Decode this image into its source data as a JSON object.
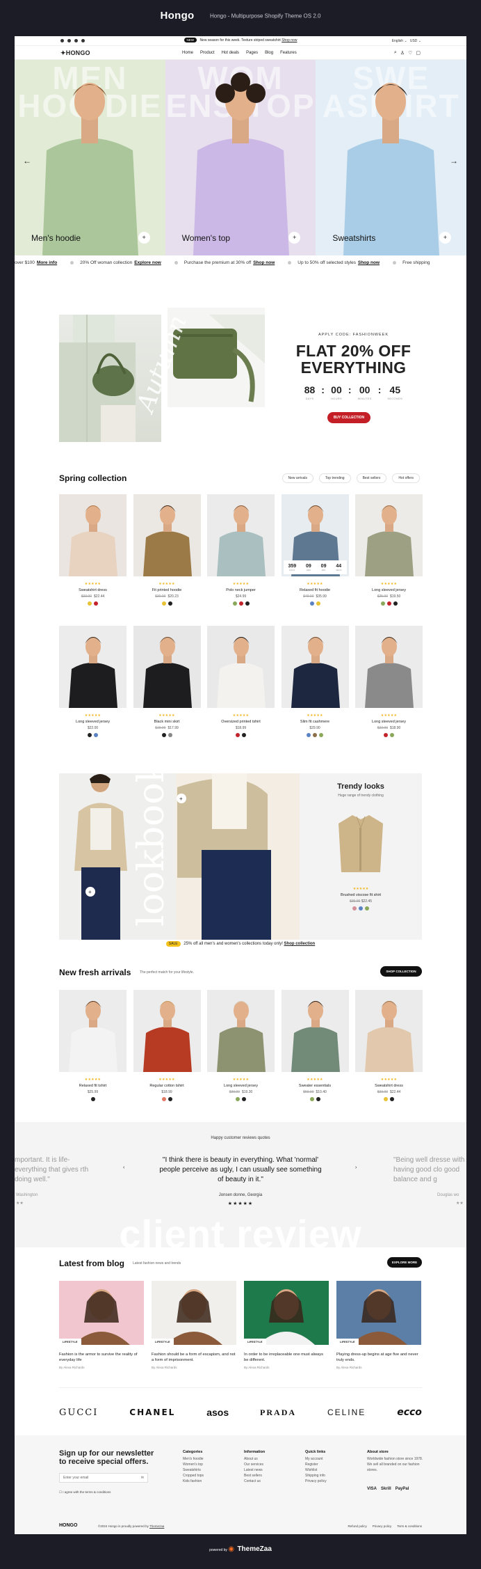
{
  "frame": {
    "logo": "Hongo",
    "subtitle": "Hongo - Multipurpose Shopify Theme OS 2.0"
  },
  "topbar": {
    "badge": "NEW",
    "announcement": "New season for this week. Texture striped sweatshirt",
    "announcement_link": "Shop now",
    "language": "English",
    "currency": "USD"
  },
  "nav": {
    "brand": "HONGO",
    "menu": [
      "Home",
      "Product",
      "Hot deals",
      "Pages",
      "Blog",
      "Features"
    ]
  },
  "hero": {
    "panels": [
      {
        "caption": "Men's hoodie",
        "bg_word": "MEN HOO DIE",
        "color": "#e2ebd6"
      },
      {
        "caption": "Women's top",
        "bg_word": "WOM ENS TOP",
        "color": "#e7dfee"
      },
      {
        "caption": "Sweatshirts",
        "bg_word": "SWE ASH IRT",
        "color": "#e3eef6"
      }
    ]
  },
  "ticker": [
    {
      "text": "over $100",
      "link": "More info"
    },
    {
      "text": "20% Off woman collection",
      "link": "Explore now"
    },
    {
      "text": "Purchase the premium at 30% off",
      "link": "Shop now"
    },
    {
      "text": "Up to 50% off selected styles",
      "link": "Shop now"
    },
    {
      "text": "Free shipping",
      "link": ""
    }
  ],
  "promo": {
    "apply_code": "APPLY CODE: FASHIONWEEK",
    "headline_1": "FLAT 20% OFF",
    "headline_2": "EVERYTHING",
    "countdown": [
      {
        "value": "88",
        "label": "DAYS"
      },
      {
        "value": "00",
        "label": "HOURS"
      },
      {
        "value": "00",
        "label": "MINUTES"
      },
      {
        "value": "45",
        "label": "SECONDS"
      }
    ],
    "button": "BUY COLLECTION",
    "script_word": "Autumn"
  },
  "spring": {
    "title": "Spring collection",
    "tabs": [
      "New arrivals",
      "Top trending",
      "Best sellers",
      "Hot offers"
    ],
    "products": [
      {
        "name": "Sweatshirt dress",
        "old": "$33.00",
        "price": "$22.44",
        "swatches": [
          "#e8c335",
          "#c3232a"
        ],
        "bg": "#eae5e1",
        "top": "#e8d3c1",
        "hair": "#b07a4a"
      },
      {
        "name": "Fit printed hoodie",
        "old": "$30.00",
        "price": "$20.23",
        "swatches": [
          "#e8c335",
          "#222222"
        ],
        "bg": "#ebe8e4",
        "top": "#9b7a48",
        "hair": "#3a2a1d"
      },
      {
        "name": "Polo neck jumper",
        "old": "",
        "price": "$24.99",
        "swatches": [
          "#8aa85a",
          "#c3232a",
          "#222222"
        ],
        "bg": "#ebebeb",
        "top": "#a9bfc0",
        "hair": "#8a5d3a"
      },
      {
        "name": "Relaxed fit hoodie",
        "old": "$49.00",
        "price": "$35.99",
        "swatches": [
          "#5b83c4",
          "#e8c335"
        ],
        "bg": "#e6ecef",
        "top": "#5e7892",
        "hair": "#6b4b31",
        "timer": [
          "359",
          "09",
          "09",
          "44"
        ],
        "timer_labels": [
          "DAYS",
          "HRS",
          "MIN",
          "SECS"
        ]
      },
      {
        "name": "Long sleeved jersey",
        "old": "$25.00",
        "price": "$19.50",
        "swatches": [
          "#8aa85a",
          "#c3232a",
          "#222222"
        ],
        "bg": "#ecebe8",
        "top": "#9ea084",
        "hair": "#9b6e44"
      },
      {
        "name": "Long sleeved jersey",
        "old": "",
        "price": "$22.00",
        "swatches": [
          "#222222",
          "#5b83c4"
        ],
        "bg": "#ececec",
        "top": "#1d1d1f",
        "hair": "#3a2a1d"
      },
      {
        "name": "Black mini skirt",
        "old": "$19.00",
        "price": "$17.99",
        "swatches": [
          "#222222",
          "#888888"
        ],
        "bg": "#e7e7e7",
        "top": "#1d1d1f",
        "hair": "#6b4b31"
      },
      {
        "name": "Oversized printed tshirt",
        "old": "",
        "price": "$18.99",
        "swatches": [
          "#c3232a",
          "#222222"
        ],
        "bg": "#e9e9e9",
        "top": "#f4f2ee",
        "hair": "#191919"
      },
      {
        "name": "Slim fit cashmere",
        "old": "",
        "price": "$29.90",
        "swatches": [
          "#5b83c4",
          "#8a6f49",
          "#8aa85a"
        ],
        "bg": "#ececec",
        "top": "#1e2740",
        "hair": "#6b4b31"
      },
      {
        "name": "Long sleeved jersey",
        "old": "$22.00",
        "price": "$18.90",
        "swatches": [
          "#c3232a",
          "#8aa85a"
        ],
        "bg": "#ebebeb",
        "top": "#8a8a8a",
        "hair": "#3a2a1d"
      }
    ]
  },
  "lookbook": {
    "bg_word": "lookbook",
    "trendy_title": "Trendy looks",
    "trendy_sub": "Huge range of trendy clothing",
    "product": {
      "name": "Brushed viscose fit shirt",
      "old": "$35.00",
      "price": "$22.45",
      "swatches": [
        "#d38f9a",
        "#5b83c4",
        "#8aa85a"
      ]
    }
  },
  "sale": {
    "badge": "SALE",
    "text": "25% off all men's and women's collections today only!",
    "link": "Shop collection"
  },
  "fresh": {
    "title": "New fresh arrivals",
    "subtitle": "The perfect match for your lifestyle.",
    "button": "SHOP COLLECTION",
    "products": [
      {
        "name": "Relaxed fit tshirt",
        "old": "",
        "price": "$25.99",
        "swatches": [
          "#222222"
        ],
        "bg": "#ececec",
        "top": "#f3f3f3",
        "hair": "#5a3c25"
      },
      {
        "name": "Regular cotton tshirt",
        "old": "",
        "price": "$18.99",
        "swatches": [
          "#e07a64",
          "#222222"
        ],
        "bg": "#ececec",
        "top": "#b73a23",
        "hair": "#c89a5a"
      },
      {
        "name": "Long sleeved jersey",
        "old": "$39.00",
        "price": "$19.30",
        "swatches": [
          "#8aa85a",
          "#222222"
        ],
        "bg": "#ebebeb",
        "top": "#8d9370",
        "hair": "#d7cfbb"
      },
      {
        "name": "Sweater essentials",
        "old": "$59.00",
        "price": "$10.40",
        "swatches": [
          "#8aa85a",
          "#222222"
        ],
        "bg": "#ececec",
        "top": "#728b79",
        "hair": "#2d2118"
      },
      {
        "name": "Sweatshirt dress",
        "old": "$33.00",
        "price": "$22.44",
        "swatches": [
          "#e8c335",
          "#222222"
        ],
        "bg": "#ebebeb",
        "top": "#e2c8ad",
        "hair": "#9b6e44"
      }
    ]
  },
  "reviews": {
    "label": "Happy customer reviews quotes",
    "quote": "\"I think there is beauty in everything. What 'normal' people perceive as ugly, I can usually see something of beauty in it.\"",
    "author": "Jonsen donne, Georgia",
    "stars": "★★★★★",
    "left_quote": "mportant. It is life- everything that gives rth doing well.\"",
    "left_author": "Washington",
    "right_quote": "\"Being well dresse with having good clo good balance and g",
    "right_author": "Douglas wo",
    "bg_word": "client review"
  },
  "blog": {
    "title": "Latest from blog",
    "subtitle": "Latest fashion news and trends",
    "button": "EXPLORE MORE",
    "posts": [
      {
        "tag": "LIFESTYLE",
        "title": "Fashion is the armor to survive the reality of everyday life",
        "author": "By Alexa Richards",
        "bg": "#f1c6cf"
      },
      {
        "tag": "LIFESTYLE",
        "title": "Fashion should be a form of escapism, and not a form of imprisonment.",
        "author": "By Alexa Richards",
        "bg": "#f0efeb"
      },
      {
        "tag": "LIFESTYLE",
        "title": "In order to be irreplaceable one must always be different.",
        "author": "By Alexa Richards",
        "bg": "#1f7a4b"
      },
      {
        "tag": "LIFESTYLE",
        "title": "Playing dress-up begins at age five and never truly ends.",
        "author": "By Alexa Richards",
        "bg": "#5b7fa6"
      }
    ]
  },
  "brands": [
    "GUCCI",
    "CHANEL",
    "asos",
    "PRADA",
    "CELINE",
    "ecco"
  ],
  "newsletter": {
    "title_1": "Sign up for our newsletter",
    "title_2": "to receive special offers.",
    "placeholder": "Enter your email",
    "agree": "I agree with the terms & conditions"
  },
  "footer_cols": [
    {
      "title": "Categories",
      "items": [
        "Men's hoodie",
        "Women's top",
        "Sweatshirts",
        "Cropped tops",
        "Kids fashion"
      ]
    },
    {
      "title": "Information",
      "items": [
        "About us",
        "Our services",
        "Latest news",
        "Best sellers",
        "Contact us"
      ]
    },
    {
      "title": "Quick links",
      "items": [
        "My account",
        "Register",
        "Wishlist",
        "Shipping info",
        "Privacy policy"
      ]
    }
  ],
  "about": {
    "title": "About store",
    "text": "Worldwide fashion store since 1978. We sell all branded on our fashion stores.",
    "pay": [
      "VISA",
      "Skrill",
      "PayPal"
    ]
  },
  "bottom": {
    "brand": "HONGO",
    "copy": "©2024 Hongo is proudly powered by",
    "copy_link": "Themezaa",
    "links": [
      "Refund policy",
      "Privacy policy",
      "Term & conditions"
    ]
  },
  "powered": {
    "label": "powered by",
    "brand": "ThemeZaa"
  }
}
